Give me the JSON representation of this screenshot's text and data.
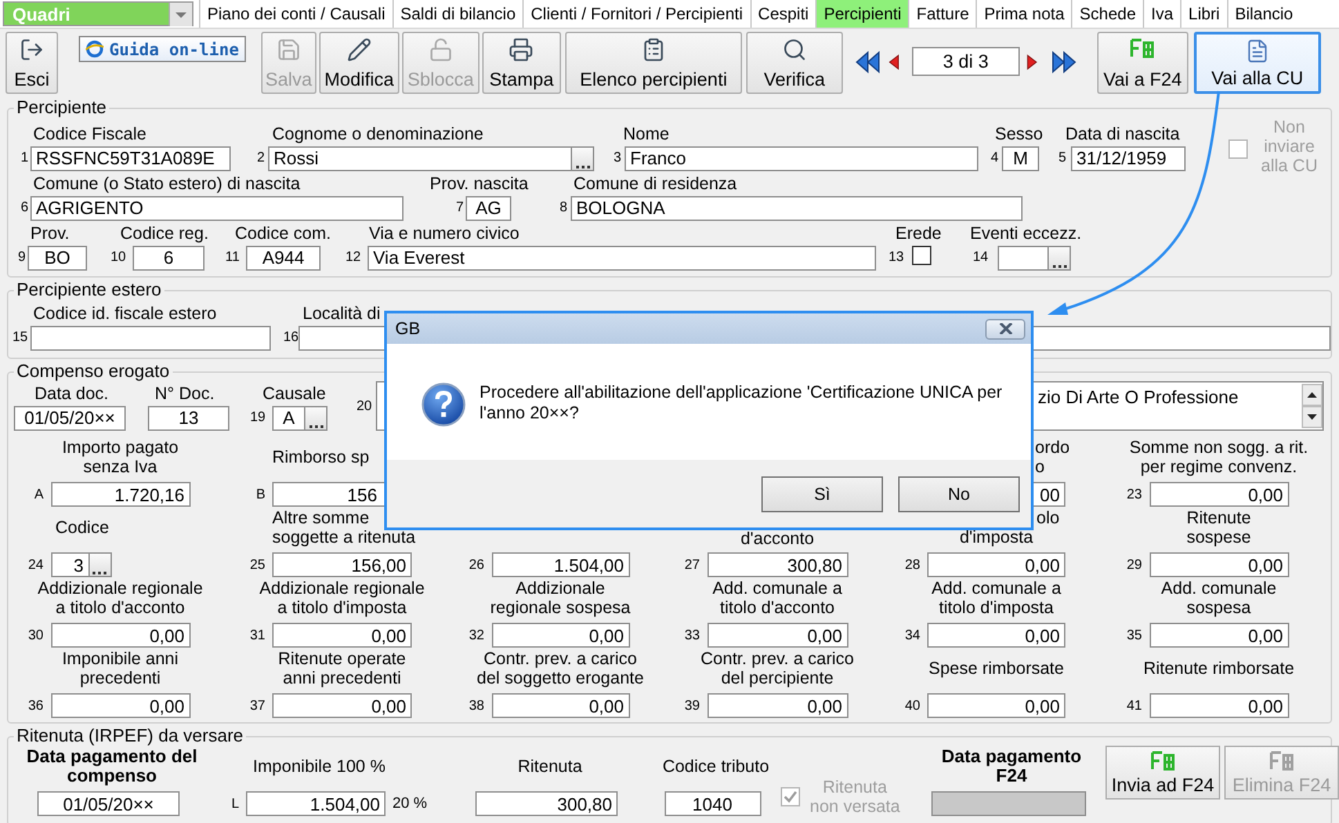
{
  "module_select": {
    "value": "Quadri"
  },
  "tabs": [
    {
      "label": "Piano dei conti / Causali",
      "selected": false
    },
    {
      "label": "Saldi di bilancio",
      "selected": false
    },
    {
      "label": "Clienti / Fornitori / Percipienti",
      "selected": false
    },
    {
      "label": "Cespiti",
      "selected": false
    },
    {
      "label": "Percipienti",
      "selected": true
    },
    {
      "label": "Fatture",
      "selected": false
    },
    {
      "label": "Prima nota",
      "selected": false
    },
    {
      "label": "Schede",
      "selected": false
    },
    {
      "label": "Iva",
      "selected": false
    },
    {
      "label": "Libri",
      "selected": false
    },
    {
      "label": "Bilancio",
      "selected": false
    }
  ],
  "toolbar": {
    "buttons": [
      {
        "kind": "exit",
        "label": "Esci",
        "disabled": false
      },
      {
        "kind": "help",
        "label": "Guida on-line"
      },
      {
        "kind": "save",
        "label": "Salva",
        "disabled": true
      },
      {
        "kind": "edit",
        "label": "Modifica",
        "disabled": false
      },
      {
        "kind": "unlock",
        "label": "Sblocca",
        "disabled": true
      },
      {
        "kind": "print",
        "label": "Stampa",
        "disabled": false
      },
      {
        "kind": "list",
        "label": "Elenco percipienti",
        "disabled": false
      },
      {
        "kind": "check",
        "label": "Verifica",
        "disabled": false
      }
    ],
    "record": "3 di 3",
    "actions": [
      {
        "kind": "f24",
        "label": "Vai a F24",
        "highlighted": false
      },
      {
        "kind": "cu",
        "label": "Vai alla CU",
        "highlighted": true
      }
    ]
  },
  "percipiente": {
    "title": "Percipiente",
    "fields": [
      {
        "num": "1",
        "label": "Codice Fiscale",
        "value": "RSSFNC59T31A089E",
        "kind": "text"
      },
      {
        "num": "2",
        "label": "Cognome o denominazione",
        "value": "Rossi",
        "kind": "lookup"
      },
      {
        "num": "3",
        "label": "Nome",
        "value": "Franco",
        "kind": "text"
      },
      {
        "num": "4",
        "label": "Sesso",
        "value": "M",
        "kind": "text"
      },
      {
        "num": "5",
        "label": "Data di nascita",
        "value": "31/12/1959",
        "kind": "text"
      },
      {
        "num": "6",
        "label": "Comune (o Stato estero) di nascita",
        "value": "AGRIGENTO",
        "kind": "text"
      },
      {
        "num": "7",
        "label": "Prov. nascita",
        "value": "AG",
        "kind": "text"
      },
      {
        "num": "8",
        "label": "Comune di residenza",
        "value": "BOLOGNA",
        "kind": "text"
      },
      {
        "num": "9",
        "label": "Prov.",
        "value": "BO",
        "kind": "text"
      },
      {
        "num": "10",
        "label": "Codice reg.",
        "value": "6",
        "kind": "text"
      },
      {
        "num": "11",
        "label": "Codice com.",
        "value": "A944",
        "kind": "text"
      },
      {
        "num": "12",
        "label": "Via e numero civico",
        "value": "Via Everest",
        "kind": "text"
      },
      {
        "num": "13",
        "label": "Erede",
        "kind": "checkbox",
        "checked": false
      },
      {
        "num": "14",
        "label": "Eventi eccezz.",
        "kind": "lookup"
      }
    ],
    "exclude": {
      "label": "Non inviare alla CU",
      "checked": false,
      "disabled": true
    }
  },
  "estero": {
    "title": "Percipiente estero",
    "fields": [
      {
        "num": "15",
        "label": "Codice id. fiscale estero",
        "kind": "text"
      },
      {
        "num": "16",
        "label": "Località di",
        "kind": "text"
      }
    ]
  },
  "compenso": {
    "title": "Compenso erogato",
    "header": [
      {
        "label": "Data doc.",
        "value": "01/05/20××",
        "kind": "text"
      },
      {
        "label": "N° Doc.",
        "value": "13",
        "kind": "text"
      },
      {
        "num": "19",
        "label": "Causale",
        "value": "A",
        "kind": "lookup"
      },
      {
        "num": "20",
        "value": "zio Di Arte O Professione",
        "kind": "memo"
      }
    ],
    "grid": [
      [
        {
          "num": "A",
          "label": [
            "Importo pagato",
            "senza Iva"
          ],
          "value": "1.720,16",
          "kind": "text"
        },
        {
          "num": "B",
          "label": [
            "Rimborso sp"
          ],
          "value": "156",
          "kind": "text"
        },
        {
          "label": [
            "ordo",
            "o"
          ],
          "value": "00",
          "kind": "text"
        },
        {
          "num": "23",
          "label": [
            "Somme non sogg. a rit.",
            "per regime convenz."
          ],
          "value": "0,00",
          "kind": "text"
        }
      ],
      [
        {
          "num": "24",
          "label": [
            "Codice"
          ],
          "value": "3",
          "kind": "lookup"
        },
        {
          "num": "25",
          "label": [
            "Altre somme",
            "soggette a ritenuta"
          ],
          "value": "156,00",
          "kind": "text"
        },
        {
          "num": "26",
          "value": "1.504,00",
          "kind": "text"
        },
        {
          "num": "27",
          "label": [
            "d'acconto"
          ],
          "value": "300,80",
          "kind": "text"
        },
        {
          "num": "28",
          "label": [
            "olo",
            "d'imposta"
          ],
          "value": "0,00",
          "kind": "text"
        },
        {
          "num": "29",
          "label": [
            "Ritenute",
            "sospese"
          ],
          "value": "0,00",
          "kind": "text"
        }
      ],
      [
        {
          "num": "30",
          "label": [
            "Addizionale regionale",
            "a titolo d'acconto"
          ],
          "value": "0,00",
          "kind": "text"
        },
        {
          "num": "31",
          "label": [
            "Addizionale regionale",
            "a titolo d'imposta"
          ],
          "value": "0,00",
          "kind": "text"
        },
        {
          "num": "32",
          "label": [
            "Addizionale",
            "regionale sospesa"
          ],
          "value": "0,00",
          "kind": "text"
        },
        {
          "num": "33",
          "label": [
            "Add. comunale a",
            "titolo d'acconto"
          ],
          "value": "0,00",
          "kind": "text"
        },
        {
          "num": "34",
          "label": [
            "Add. comunale a",
            "titolo d'imposta"
          ],
          "value": "0,00",
          "kind": "text"
        },
        {
          "num": "35",
          "label": [
            "Add. comunale",
            "sospesa"
          ],
          "value": "0,00",
          "kind": "text"
        }
      ],
      [
        {
          "num": "36",
          "label": [
            "Imponibile anni",
            "precedenti"
          ],
          "value": "0,00",
          "kind": "text"
        },
        {
          "num": "37",
          "label": [
            "Ritenute operate",
            "anni precedenti"
          ],
          "value": "0,00",
          "kind": "text"
        },
        {
          "num": "38",
          "label": [
            "Contr. prev. a carico",
            "del soggetto erogante"
          ],
          "value": "0,00",
          "kind": "text"
        },
        {
          "num": "39",
          "label": [
            "Contr. prev. a carico",
            "del percipiente"
          ],
          "value": "0,00",
          "kind": "text"
        },
        {
          "num": "40",
          "label": [
            "Spese rimborsate"
          ],
          "value": "0,00",
          "kind": "text"
        },
        {
          "num": "41",
          "label": [
            "Ritenute rimborsate"
          ],
          "value": "0,00",
          "kind": "text"
        }
      ]
    ]
  },
  "ritenuta": {
    "title": "Ritenuta (IRPEF) da versare",
    "fields": [
      {
        "kind": "text",
        "label": [
          "Data pagamento del",
          "compenso"
        ],
        "value": "01/05/20××",
        "disabled": false
      },
      {
        "kind": "text",
        "num": "L",
        "label": [
          "Imponibile 100 %"
        ],
        "value": "1.504,00",
        "suffix": "20 %",
        "disabled": false
      },
      {
        "kind": "text",
        "label": [
          "Ritenuta"
        ],
        "value": "300,80",
        "disabled": false
      },
      {
        "kind": "text",
        "label": [
          "Codice tributo"
        ],
        "value": "1040",
        "disabled": false
      },
      {
        "kind": "checkbox",
        "label": [
          "Ritenuta",
          "non versata"
        ],
        "checked": true,
        "disabled": true
      },
      {
        "kind": "text",
        "label": [
          "Data pagamento",
          "F24"
        ],
        "disabled": true
      }
    ],
    "buttons": [
      {
        "label": "Invia ad F24",
        "disabled": false
      },
      {
        "label": "Elimina F24",
        "disabled": true
      }
    ]
  },
  "dialog": {
    "title": "GB",
    "message": "Procedere all'abilitazione dell'applicazione 'Certificazione UNICA per l'anno 20××?",
    "buttons": [
      {
        "label": "Sì"
      },
      {
        "label": "No"
      }
    ]
  }
}
